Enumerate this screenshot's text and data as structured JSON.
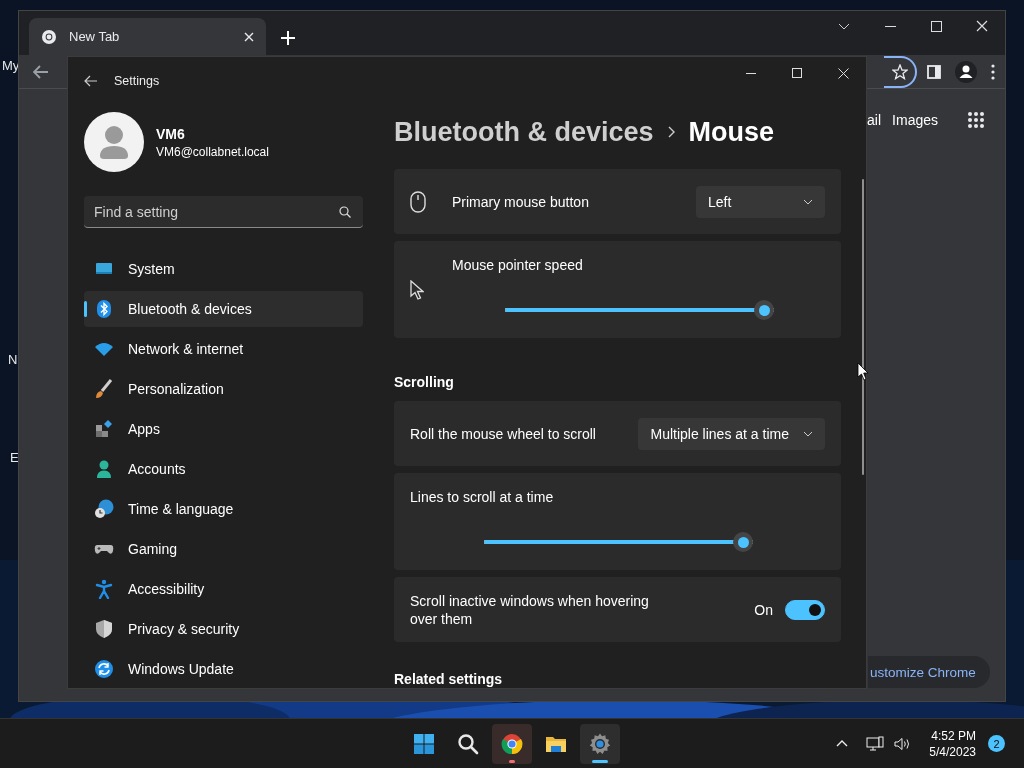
{
  "desktop": {
    "icon_labels": [
      "My",
      "N",
      "E"
    ]
  },
  "browser": {
    "tabs": [
      {
        "title": "New Tab",
        "selected": true
      }
    ],
    "header_links": [
      "ail",
      "Images"
    ],
    "customize_button": "ustomize Chrome"
  },
  "settings": {
    "title": "Settings",
    "user": {
      "name": "VM6",
      "email": "VM6@collabnet.local"
    },
    "search": {
      "placeholder": "Find a setting"
    },
    "nav": [
      {
        "label": "System",
        "selected": false
      },
      {
        "label": "Bluetooth & devices",
        "selected": true
      },
      {
        "label": "Network & internet",
        "selected": false
      },
      {
        "label": "Personalization",
        "selected": false
      },
      {
        "label": "Apps",
        "selected": false
      },
      {
        "label": "Accounts",
        "selected": false
      },
      {
        "label": "Time & language",
        "selected": false
      },
      {
        "label": "Gaming",
        "selected": false
      },
      {
        "label": "Accessibility",
        "selected": false
      },
      {
        "label": "Privacy & security",
        "selected": false
      },
      {
        "label": "Windows Update",
        "selected": false
      }
    ],
    "breadcrumb": {
      "parent": "Bluetooth & devices",
      "current": "Mouse"
    },
    "rows": [
      {
        "kind": "dropdown",
        "label": "Primary mouse button",
        "value": "Left"
      },
      {
        "kind": "slider",
        "label": "Mouse pointer speed",
        "level": 1
      },
      {
        "kind": "heading",
        "label": "Scrolling"
      },
      {
        "kind": "dropdown",
        "label": "Roll the mouse wheel to scroll",
        "value": "Multiple lines at a time"
      },
      {
        "kind": "slider",
        "label": "Lines to scroll at a time",
        "level": 1
      },
      {
        "kind": "toggle",
        "label": "Scroll inactive windows when hovering over them",
        "state_text": "On",
        "on": true
      },
      {
        "kind": "heading",
        "label": "Related settings"
      }
    ]
  },
  "taskbar": {
    "apps": [
      {
        "running": false,
        "flashing": false,
        "selected": false
      },
      {
        "running": false,
        "flashing": false,
        "selected": false
      },
      {
        "running": true,
        "flashing": true,
        "selected": false
      },
      {
        "running": false,
        "flashing": false,
        "selected": false
      },
      {
        "running": true,
        "flashing": false,
        "selected": true
      }
    ],
    "time": "4:52 PM",
    "date": "5/4/2023",
    "notification_count": "2"
  }
}
